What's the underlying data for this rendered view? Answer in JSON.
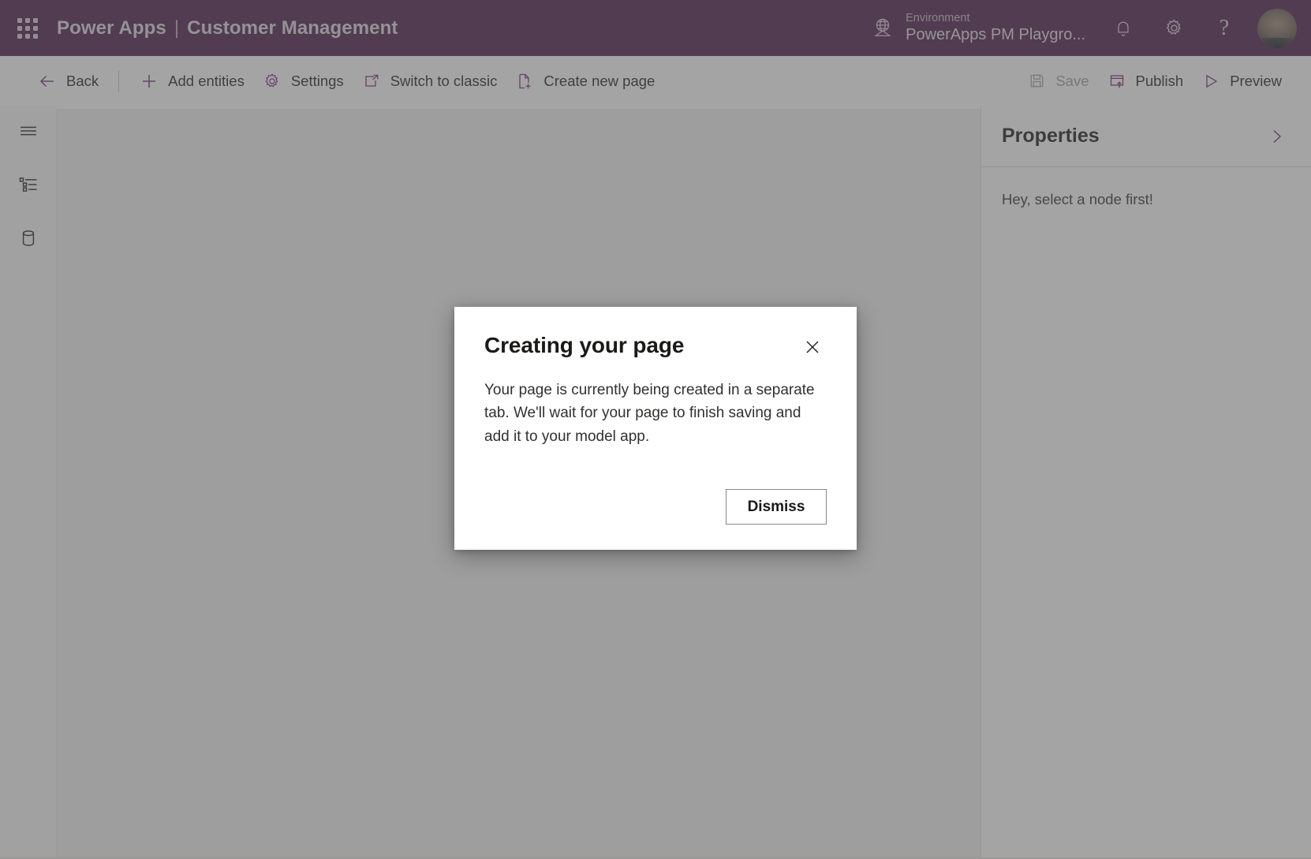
{
  "header": {
    "app_launcher_icon": "waffle-grid-icon",
    "brand": "Power Apps",
    "brand_separator": "|",
    "app_title": "Customer Management",
    "environment_label": "Environment",
    "environment_value": "PowerApps PM Playgro...",
    "environment_icon": "globe-icon",
    "notifications_icon": "bell-icon",
    "settings_icon": "gear-icon",
    "help_icon": "question-mark-icon",
    "help_glyph": "?",
    "avatar_icon": "user-avatar",
    "background_color": "#4A1A47",
    "text_color": "#DED7DD"
  },
  "commandbar": {
    "back_label": "Back",
    "add_entities_label": "Add entities",
    "settings_label": "Settings",
    "switch_to_classic_label": "Switch to classic",
    "create_new_page_label": "Create new page",
    "save_label": "Save",
    "save_disabled": "true",
    "publish_label": "Publish",
    "preview_label": "Preview",
    "accent_color": "#742774",
    "disabled_color": "#A19F9D"
  },
  "left_rail": {
    "items": [
      {
        "name": "navigation-icon",
        "label": "Navigation"
      },
      {
        "name": "tree-view-icon",
        "label": "Pages"
      },
      {
        "name": "data-icon",
        "label": "Data"
      }
    ]
  },
  "canvas": {
    "background_color": "#F3F2F1"
  },
  "properties": {
    "title": "Properties",
    "collapse_icon": "chevron-right-icon",
    "empty_message": "Hey, select a node first!"
  },
  "dialog": {
    "title": "Creating your page",
    "close_icon": "close-icon",
    "body": "Your page is currently being created in a separate tab. We'll wait for your page to finish saving and add it to your model app.",
    "dismiss_label": "Dismiss"
  }
}
